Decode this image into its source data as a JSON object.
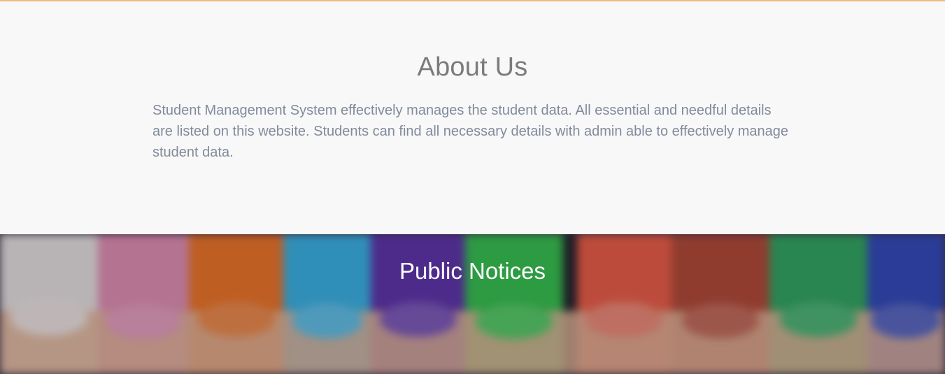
{
  "about": {
    "title": "About Us",
    "text": "Student Management System effectively manages the student data. All essential and needful details are listed on this website. Students can find all necessary details with admin able to effectively manage student data."
  },
  "notices": {
    "title": "Public Notices"
  },
  "colors": {
    "accent_rule": "#f0b97c",
    "about_background": "#f8f8f8",
    "about_title": "#7b7b7b",
    "about_text": "#818b9c",
    "notices_title": "#ffffff"
  }
}
